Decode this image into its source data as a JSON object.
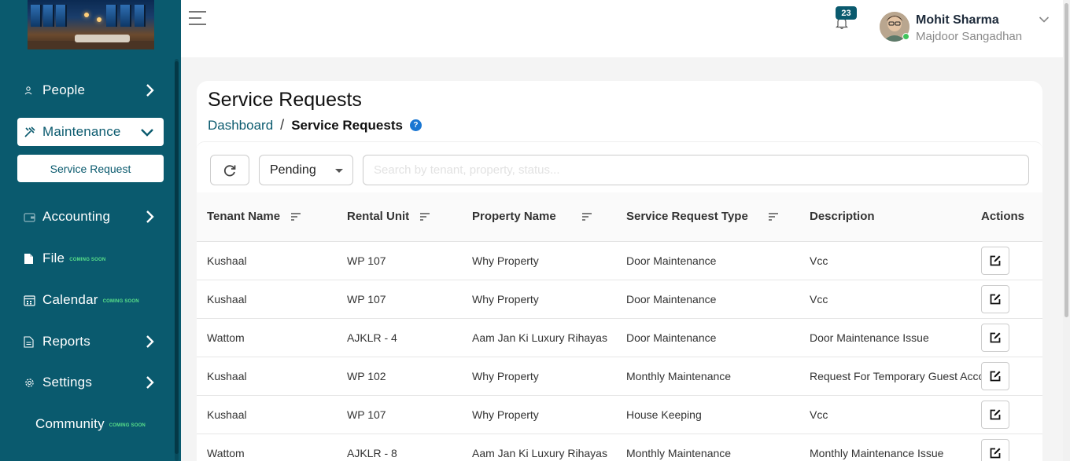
{
  "sidebar": {
    "items": [
      {
        "label": "People",
        "icon": "person-icon",
        "soon": ""
      },
      {
        "label": "Maintenance",
        "icon": "tools-icon",
        "soon": ""
      },
      {
        "label": "Accounting",
        "icon": "wallet-icon",
        "soon": ""
      },
      {
        "label": "File",
        "icon": "file-icon",
        "soon": "COMING SOON"
      },
      {
        "label": "Calendar",
        "icon": "calendar-icon",
        "soon": "COMING SOON"
      },
      {
        "label": "Reports",
        "icon": "report-icon",
        "soon": ""
      },
      {
        "label": "Settings",
        "icon": "gear-icon",
        "soon": ""
      },
      {
        "label": "Community",
        "icon": "",
        "soon": "COMING SOON"
      }
    ],
    "sub_item": "Service Request"
  },
  "header": {
    "notification_count": "23",
    "user_name": "Mohit Sharma",
    "user_org": "Majdoor Sangadhan"
  },
  "page": {
    "title": "Service Requests",
    "breadcrumb_root": "Dashboard",
    "breadcrumb_sep": "/",
    "breadcrumb_current": "Service Requests",
    "help": "?"
  },
  "toolbar": {
    "status_value": "Pending",
    "search_placeholder": "Search by tenant, property, status..."
  },
  "table": {
    "columns": [
      "Tenant Name",
      "Rental Unit",
      "Property Name",
      "Service Request Type",
      "Description",
      "Actions"
    ],
    "rows": [
      [
        "Kushaal",
        "WP 107",
        "Why Property",
        "Door Maintenance",
        "Vcc"
      ],
      [
        "Kushaal",
        "WP 107",
        "Why Property",
        "Door Maintenance",
        "Vcc"
      ],
      [
        "Wattom",
        "AJKLR - 4",
        "Aam Jan Ki Luxury Rihayas",
        "Door Maintenance",
        "Door Maintenance Issue"
      ],
      [
        "Kushaal",
        "WP 102",
        "Why Property",
        "Monthly Maintenance",
        "Request For Temporary Guest Accommodation"
      ],
      [
        "Kushaal",
        "WP 107",
        "Why Property",
        "House Keeping",
        "Vcc"
      ],
      [
        "Wattom",
        "AJKLR - 8",
        "Aam Jan Ki Luxury Rihayas",
        "Monthly Maintenance",
        "Monthly Maintenance Issue"
      ]
    ]
  },
  "colors": {
    "brand": "#0a5a6e",
    "online": "#3fc35a",
    "coming_soon": "#59e08a"
  }
}
